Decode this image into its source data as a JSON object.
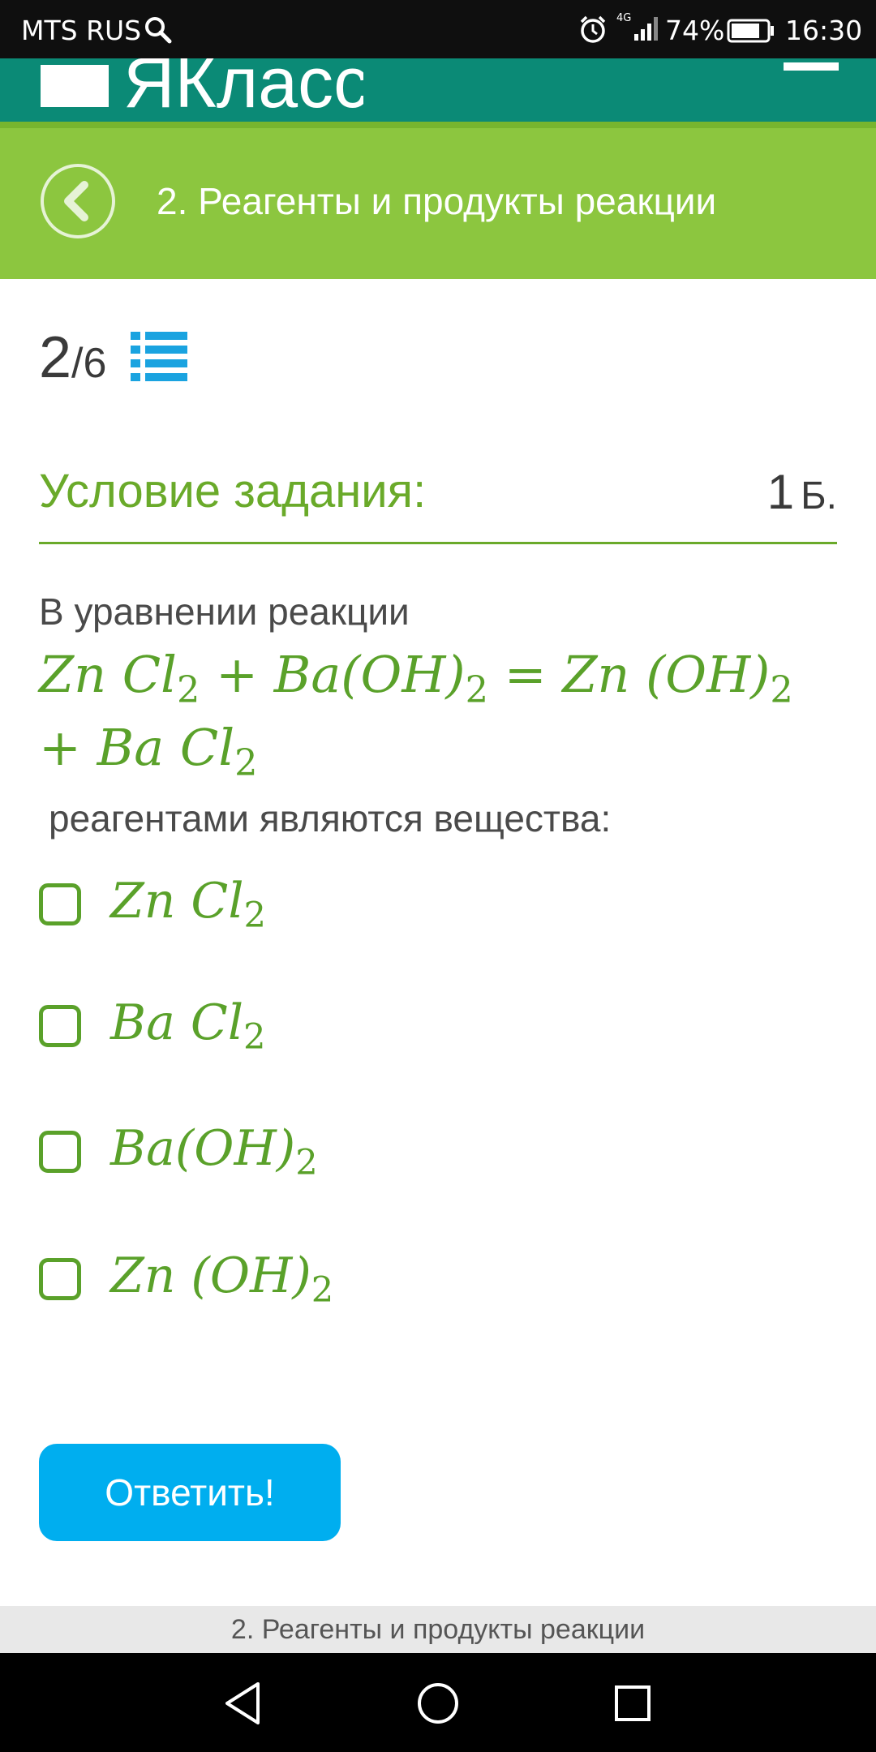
{
  "status_bar": {
    "carrier": "MTS RUS",
    "network": "4G",
    "battery": "74%",
    "time": "16:30"
  },
  "app_header": {
    "logo_text": "ЯКласс"
  },
  "lesson": {
    "title": "2. Реагенты и продукты реакции"
  },
  "progress": {
    "current": "2",
    "separator": "/",
    "total": "6"
  },
  "task": {
    "heading": "Условие задания:",
    "points_value": "1",
    "points_unit": "Б.",
    "intro": "В уравнении реакции",
    "outro": "реагентами являются вещества:"
  },
  "equation": {
    "line1": [
      {
        "t": "Zn Cl"
      },
      {
        "s": "2"
      },
      {
        "t": " + Ba(OH)"
      },
      {
        "s": "2"
      },
      {
        "t": " = Zn (OH)"
      },
      {
        "s": "2"
      }
    ],
    "line2": [
      {
        "t": "+ Ba Cl"
      },
      {
        "s": "2"
      }
    ]
  },
  "options": [
    {
      "parts": [
        {
          "t": "Zn Cl"
        },
        {
          "s": "2"
        }
      ],
      "checked": false
    },
    {
      "parts": [
        {
          "t": "Ba Cl"
        },
        {
          "s": "2"
        }
      ],
      "checked": false
    },
    {
      "parts": [
        {
          "t": "Ba(OH)"
        },
        {
          "s": "2"
        }
      ],
      "checked": false
    },
    {
      "parts": [
        {
          "t": "Zn (OH)"
        },
        {
          "s": "2"
        }
      ],
      "checked": false
    }
  ],
  "submit_label": "Ответить!",
  "footer_label": "2. Реагенты и продукты реакции",
  "colors": {
    "header_teal": "#0b8a76",
    "lesson_green": "#8cc63f",
    "formula_green": "#5aa12a",
    "button_blue": "#00aeef",
    "list_icon_blue": "#1aa3e0"
  },
  "icons": {
    "back": "chevron-left-circle-icon",
    "list": "list-icon",
    "menu": "hamburger-menu-icon",
    "nav_back": "triangle-back-icon",
    "nav_home": "circle-home-icon",
    "nav_recent": "square-recent-icon"
  }
}
